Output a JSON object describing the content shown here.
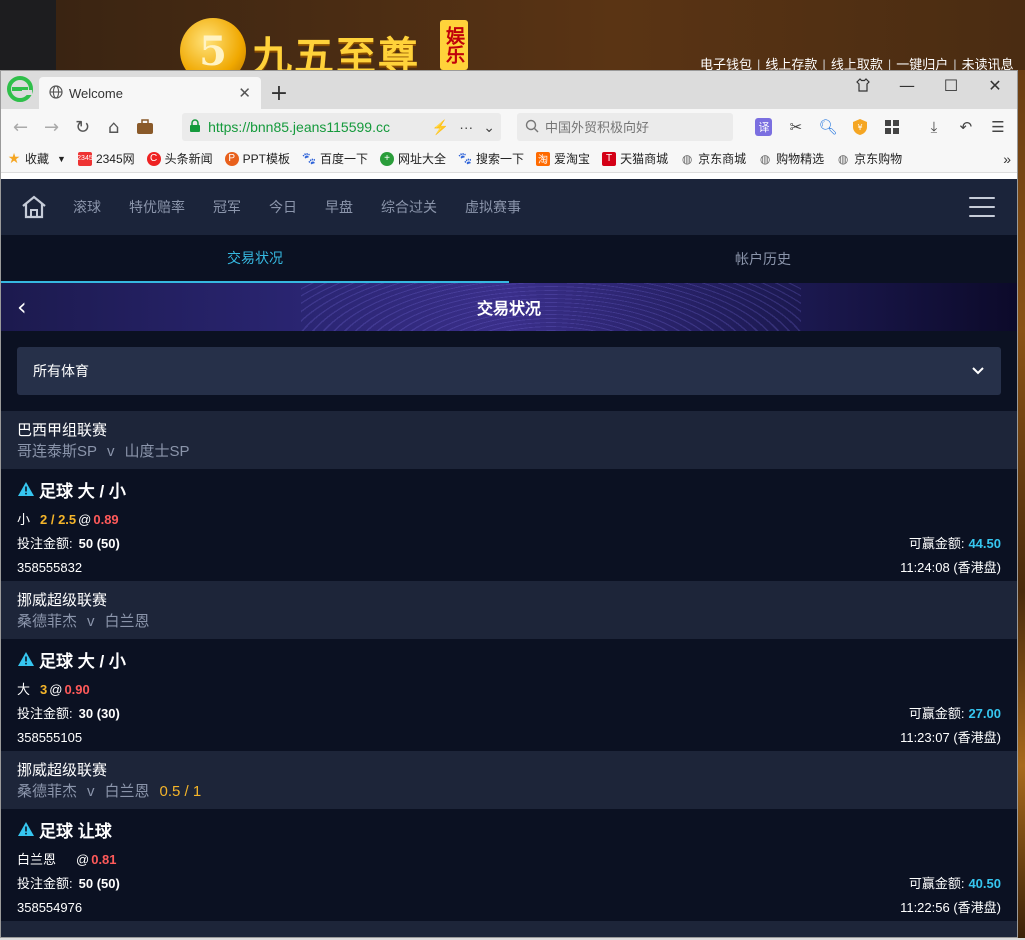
{
  "background_site": {
    "logo_numeral": "5",
    "logo_text": "九五至尊",
    "logo_badge": "娱乐",
    "links": [
      "电子钱包",
      "线上存款",
      "线上取款",
      "一键归户",
      "未读讯息"
    ]
  },
  "browser": {
    "tab_title": "Welcome",
    "url": "https://bnn85.jeans115599.cc",
    "search_placeholder": "中国外贸积极向好",
    "bookmarks": [
      "收藏",
      "2345网",
      "头条新闻",
      "PPT模板",
      "百度一下",
      "网址大全",
      "搜索一下",
      "爱淘宝",
      "天猫商城",
      "京东商城",
      "购物精选",
      "京东购物"
    ]
  },
  "nav": {
    "items": [
      "滚球",
      "特优赔率",
      "冠军",
      "今日",
      "早盘",
      "综合过关",
      "虚拟赛事"
    ]
  },
  "subtabs": {
    "active": "交易状况",
    "other": "帐户历史"
  },
  "banner_title": "交易状况",
  "filter_label": "所有体育",
  "labels": {
    "stake": "投注金额:",
    "win": "可赢金额:"
  },
  "bets": [
    {
      "league": "巴西甲组联赛",
      "home": "哥连泰斯SP",
      "vs": "v",
      "away": "山度士SP",
      "handicap_in_header": "",
      "bet_type": "足球 大 / 小",
      "selection": "小",
      "line": "2 / 2.5",
      "at": "@",
      "odds": "0.89",
      "stake": "50 (50)",
      "win": "44.50",
      "ticket": "358555832",
      "time": "11:24:08 (香港盘)"
    },
    {
      "league": "挪威超级联赛",
      "home": "桑德菲杰",
      "vs": "v",
      "away": "白兰恩",
      "handicap_in_header": "",
      "bet_type": "足球 大 / 小",
      "selection": "大",
      "line": "3",
      "at": "@",
      "odds": "0.90",
      "stake": "30 (30)",
      "win": "27.00",
      "ticket": "358555105",
      "time": "11:23:07 (香港盘)"
    },
    {
      "league": "挪威超级联赛",
      "home": "桑德菲杰",
      "vs": "v",
      "away": "白兰恩",
      "handicap_in_header": "0.5 / 1",
      "bet_type": "足球 让球",
      "selection": "白兰恩",
      "line": "",
      "at": "@",
      "odds": "0.81",
      "stake": "50 (50)",
      "win": "40.50",
      "ticket": "358554976",
      "time": "11:22:56 (香港盘)"
    }
  ],
  "colors": {
    "page_bg": "#0b1122",
    "nav_bg": "#1b243a",
    "accent_cyan": "#36b8e0",
    "odds_red": "#ff5a5a",
    "line_yellow": "#f5b52a"
  }
}
